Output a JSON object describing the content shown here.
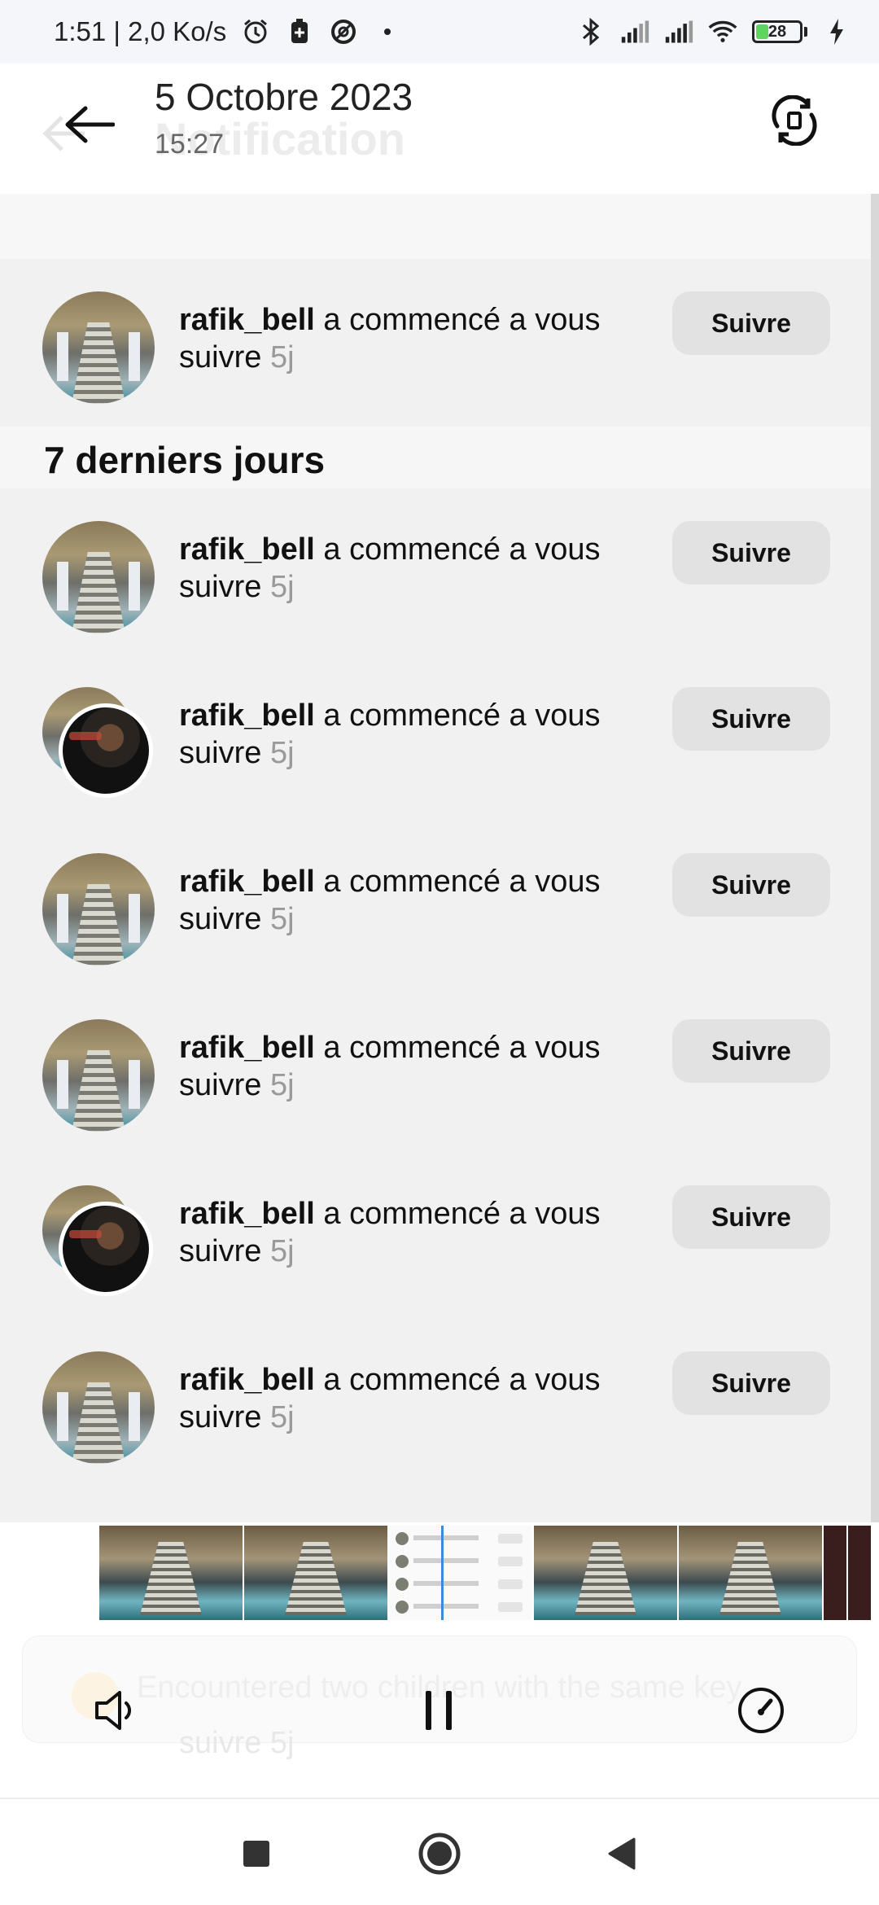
{
  "status_bar": {
    "time_speed": "1:51 | 2,0 Ko/s",
    "battery": "28",
    "icons": [
      "alarm-icon",
      "battery-saver-icon",
      "data-saver-icon",
      "dot-icon",
      "bluetooth-icon",
      "signal-icon",
      "signal-icon",
      "wifi-icon",
      "charging-icon"
    ]
  },
  "header": {
    "date": "5 Octobre 2023",
    "time": "15:27",
    "ghost_title": "Notification"
  },
  "notifications_top": [
    {
      "username": "rafik_bell",
      "message": " a commencé a vous suivre",
      "age": "5j",
      "button": "Suivre",
      "avatar": "staircase"
    }
  ],
  "section": {
    "title": "7 derniers jours"
  },
  "notifications": [
    {
      "username": "rafik_bell",
      "message": " a commencé a vous suivre",
      "age": "5j",
      "button": "Suivre",
      "avatar": "staircase"
    },
    {
      "username": "rafik_bell",
      "message": " a commencé a vous suivre",
      "age": "5j",
      "button": "Suivre",
      "avatar": "stacked"
    },
    {
      "username": "rafik_bell",
      "message": " a commencé a vous suivre",
      "age": "5j",
      "button": "Suivre",
      "avatar": "staircase"
    },
    {
      "username": "rafik_bell",
      "message": " a commencé a vous suivre",
      "age": "5j",
      "button": "Suivre",
      "avatar": "staircase"
    },
    {
      "username": "rafik_bell",
      "message": " a commencé a vous suivre",
      "age": "5j",
      "button": "Suivre",
      "avatar": "stacked"
    },
    {
      "username": "rafik_bell",
      "message": " a commencé a vous suivre",
      "age": "5j",
      "button": "Suivre",
      "avatar": "staircase"
    }
  ],
  "ghost": {
    "toast": "Encountered two children with the same key",
    "row_text": "suivre 5j"
  },
  "player_controls": [
    "volume-icon",
    "pause-icon",
    "speed-icon"
  ],
  "nav": [
    "recent-apps-button",
    "home-button",
    "back-button"
  ],
  "colors": {
    "button_bg": "#e2e2e2",
    "page_bg": "#f1f1f1",
    "battery_fill": "#5fd45f"
  }
}
